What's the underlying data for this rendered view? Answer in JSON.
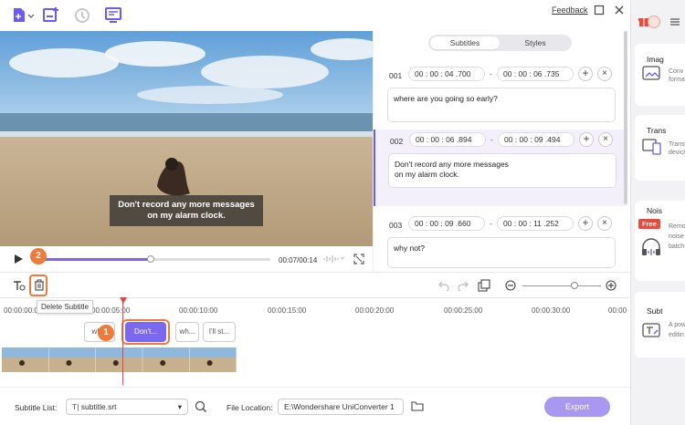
{
  "toolbar": {
    "feedback_label": "Feedback",
    "icons": [
      "add-file-icon",
      "add-subtitle-icon",
      "auto-sync-icon",
      "subtitle-editor-icon"
    ]
  },
  "video": {
    "caption_line1": "Don't record any more messages",
    "caption_line2": "on my alarm clock."
  },
  "playback": {
    "time": "00:07/00:14",
    "progress": 0.5
  },
  "subtitle_panel": {
    "tabs": [
      "Subtitles",
      "Styles"
    ],
    "active_tab": "Subtitles",
    "entries": [
      {
        "num": "001",
        "start": "00 : 00 : 04 .700",
        "end": "00 : 00 : 06 .735",
        "text": "where are you going so early?"
      },
      {
        "num": "002",
        "start": "00 : 00 : 06 .894",
        "end": "00 : 00 : 09 .494",
        "text_line1": "Don't record any more messages",
        "text_line2": "on my alarm clock."
      },
      {
        "num": "003",
        "start": "00 : 00 : 09 .660",
        "end": "00 : 00 : 11 .252",
        "text": "why not?"
      }
    ]
  },
  "rightbar": {
    "cards": [
      {
        "title": "Imag",
        "desc1": "Conv",
        "desc2": "forma"
      },
      {
        "title": "Trans",
        "desc1": "Transf",
        "desc2": "device"
      },
      {
        "title": "Nois",
        "desc1": "Remo",
        "desc2": "noise",
        "desc3": "batch"
      },
      {
        "title": "Subt",
        "desc1": "A pow",
        "desc2": "editin"
      }
    ],
    "free_badge": "Free"
  },
  "timeline": {
    "tooltip": "Delete Subtitle",
    "ruler": [
      "00:00:00:00",
      "00:00:05:00",
      "00:00:10:00",
      "00:00:15:00",
      "00:00:20:00",
      "00:00:25:00",
      "00:00:30:00",
      "00:00"
    ],
    "chips": [
      "wh...",
      "Don't...",
      "wh...",
      "I'll st..."
    ],
    "step1": "1",
    "step2": "2"
  },
  "bottom": {
    "subtitle_list_label": "Subtitle List:",
    "subtitle_file": "subtitle.srt",
    "file_location_label": "File Location:",
    "file_location_value": "E:\\Wondershare UniConverter 1",
    "export_label": "Export"
  },
  "colors": {
    "accent": "#7b68ee",
    "highlight": "#ef7a3a",
    "playhead": "#e54545"
  }
}
